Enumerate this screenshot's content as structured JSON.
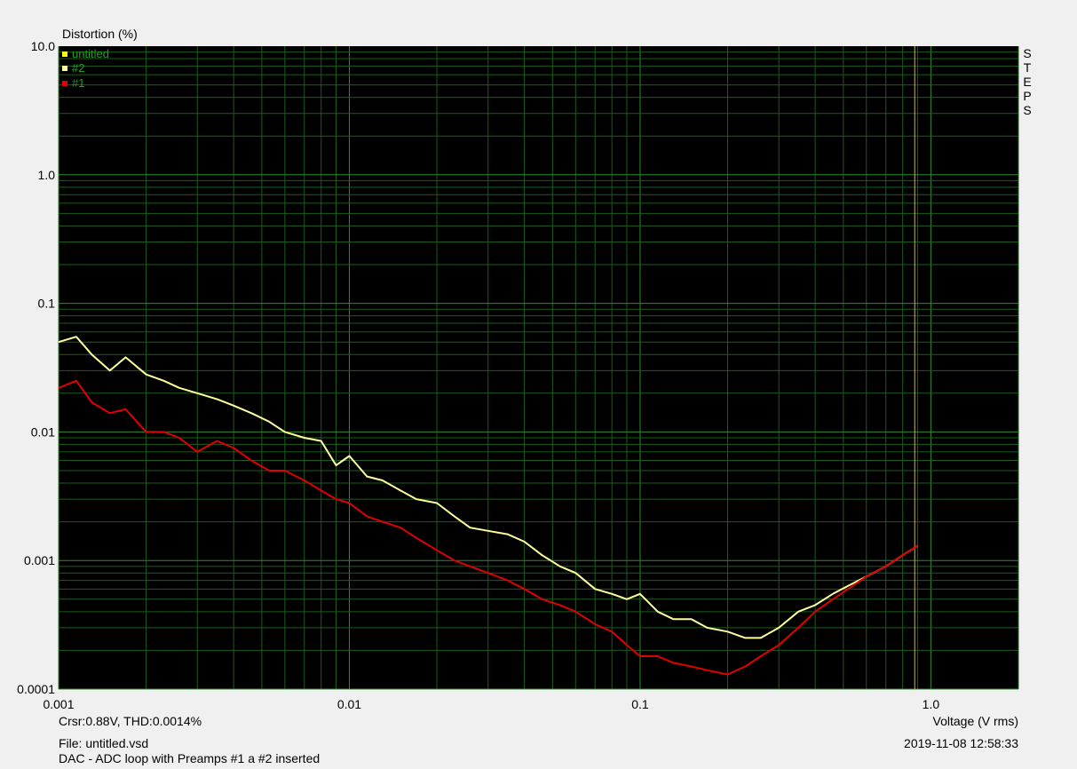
{
  "chart_data": {
    "type": "line",
    "ylabel": "Distortion (%)",
    "xlabel": "Voltage (V rms)",
    "x_scale": "log",
    "y_scale": "log",
    "xlim": [
      0.001,
      2.0
    ],
    "ylim": [
      0.0001,
      10.0
    ],
    "x_ticks": [
      "0.001",
      "0.01",
      "0.1",
      "1.0"
    ],
    "y_ticks": [
      "10.0",
      "1.0",
      "0.1",
      "0.01",
      "0.001",
      "0.0001"
    ],
    "grid": true,
    "legend_position": "top-left",
    "legend": [
      "untitled",
      "#2",
      "#1"
    ],
    "cursor_x": 0.88,
    "series": [
      {
        "name": "#2",
        "color": "#ffff99",
        "x": [
          0.001,
          0.00115,
          0.0013,
          0.0015,
          0.0017,
          0.002,
          0.0023,
          0.0026,
          0.003,
          0.0035,
          0.004,
          0.0046,
          0.0053,
          0.006,
          0.007,
          0.008,
          0.009,
          0.01,
          0.0115,
          0.013,
          0.015,
          0.017,
          0.02,
          0.023,
          0.026,
          0.03,
          0.035,
          0.04,
          0.046,
          0.053,
          0.06,
          0.07,
          0.08,
          0.09,
          0.1,
          0.115,
          0.13,
          0.15,
          0.17,
          0.2,
          0.23,
          0.26,
          0.3,
          0.35,
          0.4,
          0.46,
          0.53,
          0.6,
          0.7,
          0.8,
          0.9
        ],
        "y": [
          0.05,
          0.055,
          0.04,
          0.03,
          0.038,
          0.028,
          0.025,
          0.022,
          0.02,
          0.018,
          0.016,
          0.014,
          0.012,
          0.01,
          0.009,
          0.0085,
          0.0055,
          0.0065,
          0.0045,
          0.0042,
          0.0035,
          0.003,
          0.0028,
          0.0022,
          0.0018,
          0.0017,
          0.0016,
          0.0014,
          0.0011,
          0.0009,
          0.0008,
          0.0006,
          0.00055,
          0.0005,
          0.00055,
          0.0004,
          0.00035,
          0.00035,
          0.0003,
          0.00028,
          0.00025,
          0.00025,
          0.0003,
          0.0004,
          0.00045,
          0.00055,
          0.00065,
          0.00075,
          0.0009,
          0.0011,
          0.0013
        ]
      },
      {
        "name": "#1",
        "color": "#e00000",
        "x": [
          0.001,
          0.00115,
          0.0013,
          0.0015,
          0.0017,
          0.002,
          0.0023,
          0.0026,
          0.003,
          0.0035,
          0.004,
          0.0046,
          0.0053,
          0.006,
          0.007,
          0.008,
          0.009,
          0.01,
          0.0115,
          0.013,
          0.015,
          0.017,
          0.02,
          0.023,
          0.026,
          0.03,
          0.035,
          0.04,
          0.046,
          0.053,
          0.06,
          0.07,
          0.08,
          0.09,
          0.1,
          0.115,
          0.13,
          0.15,
          0.17,
          0.2,
          0.23,
          0.26,
          0.3,
          0.35,
          0.4,
          0.46,
          0.53,
          0.6,
          0.7,
          0.8,
          0.9
        ],
        "y": [
          0.022,
          0.025,
          0.017,
          0.014,
          0.015,
          0.01,
          0.01,
          0.009,
          0.007,
          0.0085,
          0.0075,
          0.006,
          0.005,
          0.005,
          0.0042,
          0.0035,
          0.003,
          0.0028,
          0.0022,
          0.002,
          0.0018,
          0.0015,
          0.0012,
          0.001,
          0.0009,
          0.0008,
          0.0007,
          0.0006,
          0.0005,
          0.00045,
          0.0004,
          0.00032,
          0.00028,
          0.00022,
          0.00018,
          0.00018,
          0.00016,
          0.00015,
          0.00014,
          0.00013,
          0.00015,
          0.00018,
          0.00022,
          0.0003,
          0.0004,
          0.0005,
          0.00062,
          0.00075,
          0.0009,
          0.0011,
          0.0013
        ]
      }
    ]
  },
  "legend_colors": {
    "untitled": "#ffff00",
    "#2": "#ffff99",
    "#1": "#e00000"
  },
  "steps_text": [
    "S",
    "T",
    "E",
    "P",
    "S"
  ],
  "cursor_readout": "Crsr:0.88V, THD:0.0014%",
  "file_label": "File: untitled.vsd",
  "description": "DAC - ADC loop with Preamps #1 a #2 inserted",
  "timestamp": "2019-11-08  12:58:33"
}
